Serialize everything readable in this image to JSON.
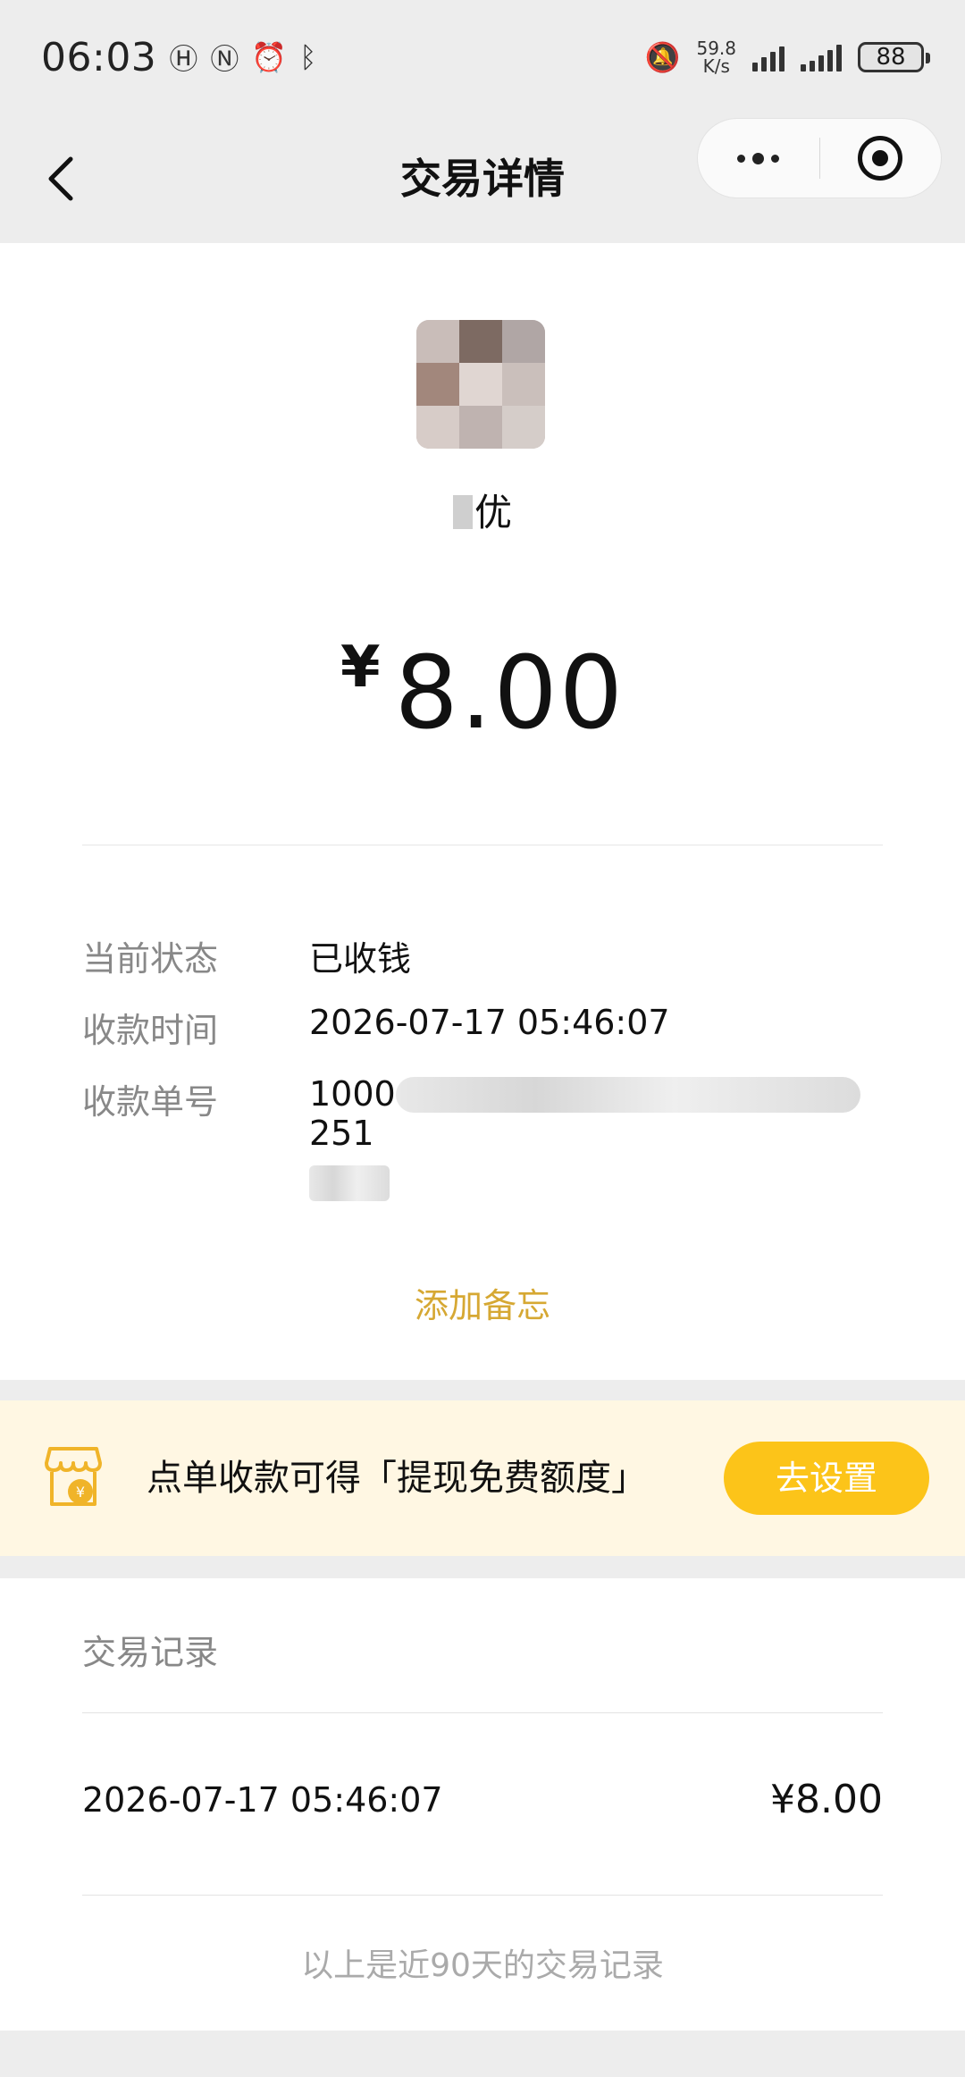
{
  "status_bar": {
    "time": "06:03",
    "net_speed_value": "59.8",
    "net_speed_unit": "K/s",
    "battery": "88",
    "left_icons": [
      "hd-voice-icon",
      "nfc-icon",
      "alarm-icon",
      "bluetooth-icon"
    ],
    "right_icons": [
      "mute-icon",
      "signal-icon",
      "signal-icon"
    ]
  },
  "nav": {
    "title": "交易详情"
  },
  "merchant": {
    "name_visible": "优"
  },
  "amount": {
    "currency": "¥",
    "value": "8.00"
  },
  "details": [
    {
      "key": "当前状态",
      "value": "已收钱"
    },
    {
      "key": "收款时间",
      "value": "2026-07-17 05:46:07"
    },
    {
      "key": "收款单号",
      "value_start": "1000",
      "value_end": "251"
    }
  ],
  "add_memo": "添加备忘",
  "banner": {
    "text": "点单收款可得「提现免费额度」",
    "button": "去设置",
    "accent_color": "#fcc419"
  },
  "records": {
    "title": "交易记录",
    "items": [
      {
        "time": "2026-07-17 05:46:07",
        "amount": "¥8.00"
      }
    ],
    "footer": "以上是近90天的交易记录"
  },
  "colors": {
    "background": "#ededed",
    "memo_link": "#d6a833",
    "banner_bg": "#fff7e3"
  }
}
